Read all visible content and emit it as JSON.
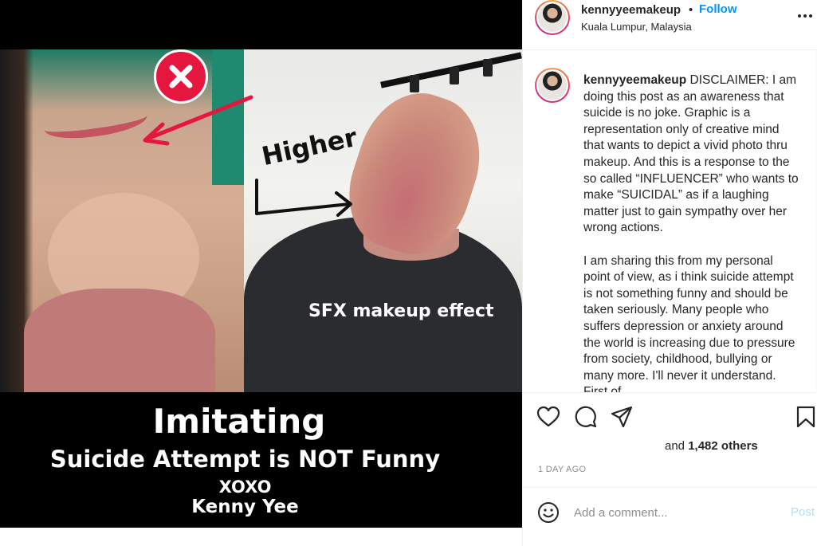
{
  "post": {
    "image": {
      "overlay_higher": "Higher",
      "overlay_sfx": "SFX makeup effect",
      "caption_line_1": "Imitating",
      "caption_line_2": "Suicide Attempt is NOT Funny",
      "caption_line_3": "XOXO",
      "caption_line_4": "Kenny Yee"
    },
    "header": {
      "username": "kennyyeemakeup",
      "separator": "•",
      "follow_label": "Follow",
      "location": "Kuala Lumpur, Malaysia",
      "more_icon": "more-horizontal-icon"
    },
    "comment": {
      "username": "kennyyeemakeup",
      "text": " DISCLAIMER: I am doing this post as an awareness that suicide is no joke. Graphic is a representation only of creative mind that wants to depict a vivid photo thru makeup. And this is a response to the so called “INFLUENCER” who wants to make “SUICIDAL” as if a laughing matter just to gain sympathy over her wrong actions.\n\nI am sharing this from my personal point of view, as i think suicide attempt is not something funny and should be taken seriously. Many people who suffers depression or anxiety around the world is increasing due to pressure from society, childhood, bullying or many more. I'll never it understand. First of"
    },
    "actions": {
      "like_icon": "heart-icon",
      "comment_icon": "comment-icon",
      "share_icon": "send-icon",
      "save_icon": "bookmark-icon"
    },
    "likes": {
      "prefix": "and ",
      "count": "1,482 others"
    },
    "date": "1 DAY AGO",
    "add_comment": {
      "placeholder": "Add a comment...",
      "post_label": "Post",
      "emoji_icon": "smiley-icon"
    },
    "colors": {
      "link_blue": "#0095f6",
      "post_disabled": "#b2dffc",
      "badge_red": "#e5173f"
    }
  }
}
